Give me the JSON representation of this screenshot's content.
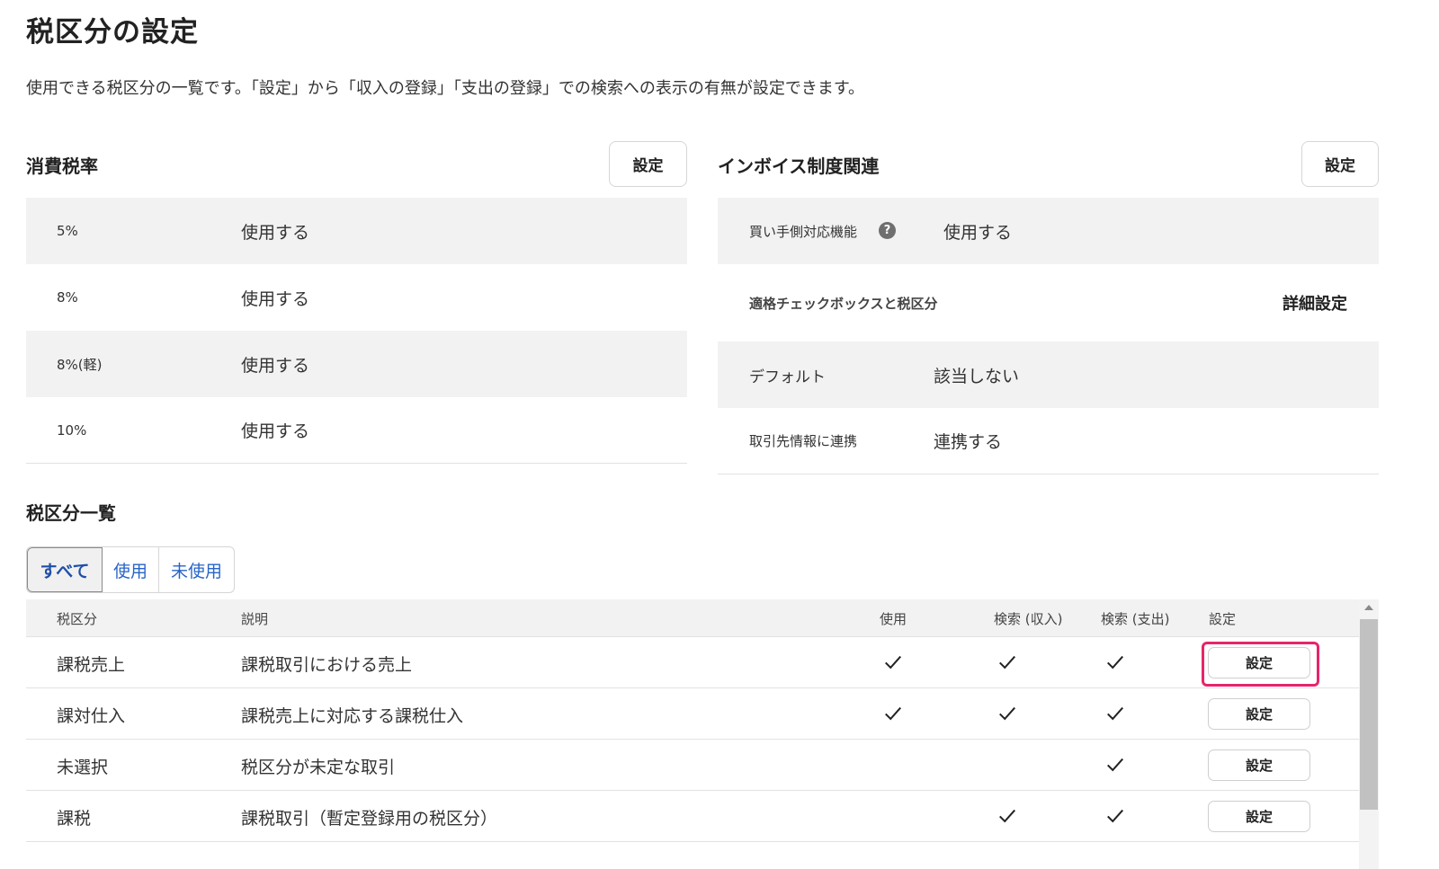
{
  "page": {
    "title": "税区分の設定",
    "description": "使用できる税区分の一覧です。「設定」から「収入の登録」「支出の登録」での検索への表示の有無が設定できます。"
  },
  "consumption_tax": {
    "heading": "消費税率",
    "settings_label": "設定",
    "rows": [
      {
        "rate": "5%",
        "status": "使用する"
      },
      {
        "rate": "8%",
        "status": "使用する"
      },
      {
        "rate": "8%(軽)",
        "status": "使用する"
      },
      {
        "rate": "10%",
        "status": "使用する"
      }
    ]
  },
  "invoice": {
    "heading": "インボイス制度関連",
    "settings_label": "設定",
    "buyer_feature": {
      "label": "買い手側対応機能",
      "help_icon": "?",
      "value": "使用する"
    },
    "checkbox_section": {
      "label": "適格チェックボックスと税区分",
      "detail_link": "詳細設定"
    },
    "default": {
      "label": "デフォルト",
      "value": "該当しない"
    },
    "partner_link": {
      "label": "取引先情報に連携",
      "value": "連携する"
    }
  },
  "tax_list": {
    "heading": "税区分一覧",
    "tabs": [
      "すべて",
      "使用",
      "未使用"
    ],
    "active_tab": "すべて",
    "columns": [
      "税区分",
      "説明",
      "使用",
      "検索 (収入)",
      "検索 (支出)",
      "設定"
    ],
    "button_label": "設定",
    "rows": [
      {
        "name": "課税売上",
        "desc": "課税取引における売上",
        "use": true,
        "search_in": true,
        "search_out": true
      },
      {
        "name": "課対仕入",
        "desc": "課税売上に対応する課税仕入",
        "use": true,
        "search_in": true,
        "search_out": true
      },
      {
        "name": "未選択",
        "desc": "税区分が未定な取引",
        "use": false,
        "search_in": false,
        "search_out": true
      },
      {
        "name": "課税",
        "desc": "課税取引（暫定登録用の税区分）",
        "use": false,
        "search_in": true,
        "search_out": true
      }
    ]
  },
  "colors": {
    "accent_link": "#2864c8",
    "highlight": "#e8246b",
    "row_shade": "#f2f2f2"
  }
}
